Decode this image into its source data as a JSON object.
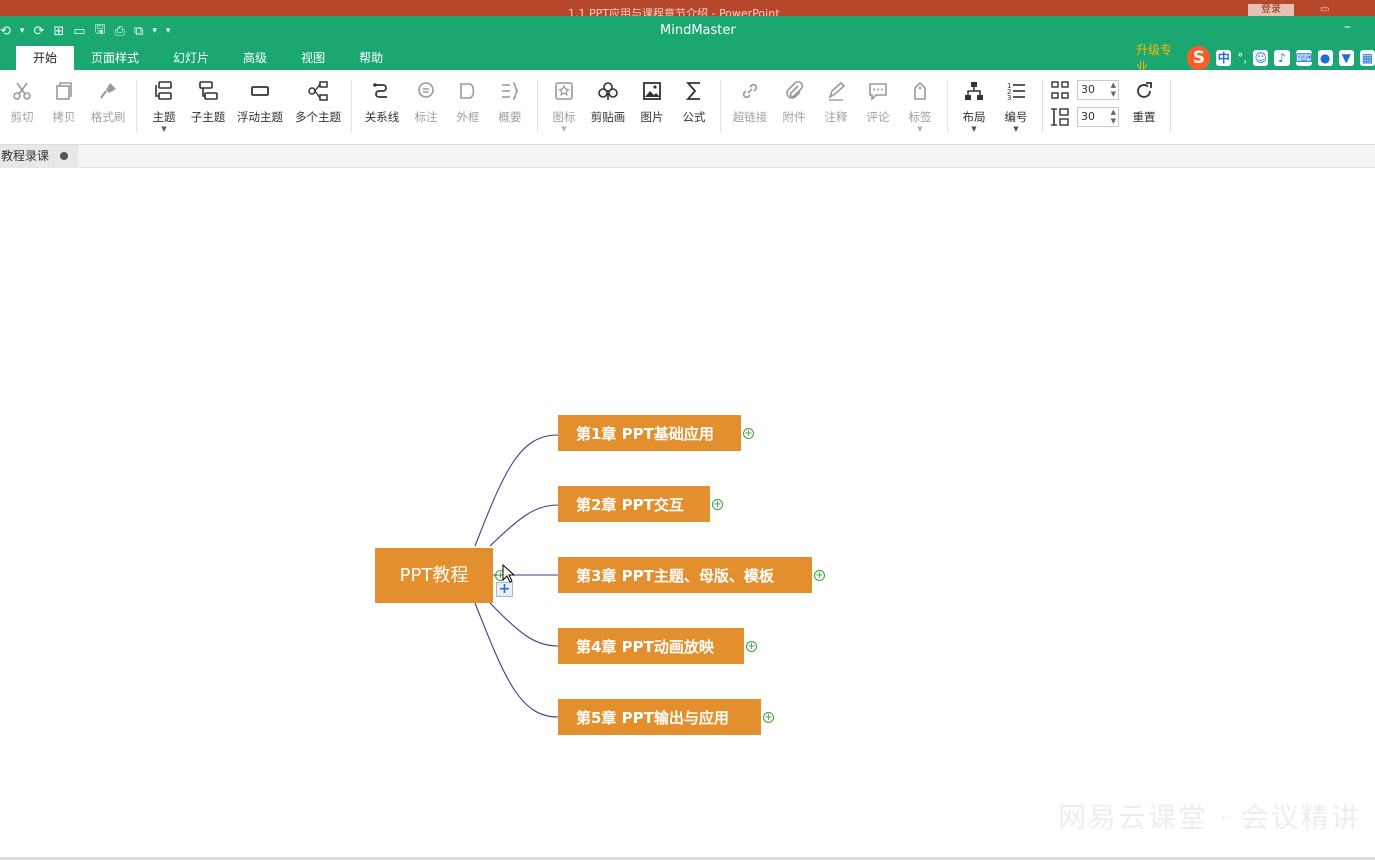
{
  "ppt_window": {
    "title": "1.1 PPT应用与课程章节介绍  -  PowerPoint",
    "login": "登录"
  },
  "app": {
    "title": "MindMaster",
    "minimize": "–"
  },
  "qat": {
    "items": [
      "⟲",
      "▾",
      "⟳",
      "⊞",
      "▭",
      "🖫",
      "⎙",
      "⧉",
      "▾",
      "▾"
    ]
  },
  "tabs": [
    "开始",
    "页面样式",
    "幻灯片",
    "高级",
    "视图",
    "帮助"
  ],
  "active_tab": "开始",
  "ime": {
    "upgrade": "升级专业",
    "s": "S",
    "zh": "中",
    "punct": "°,"
  },
  "ribbon": {
    "buttons": [
      {
        "label": "剪切",
        "icon": "scissors-icon",
        "disabled": true
      },
      {
        "label": "拷贝",
        "icon": "copy-icon",
        "disabled": true
      },
      {
        "label": "格式刷",
        "icon": "format-painter-icon",
        "disabled": true
      },
      {
        "label": "主题",
        "icon": "topic-icon",
        "disabled": false,
        "caret": true
      },
      {
        "label": "子主题",
        "icon": "subtopic-icon",
        "disabled": false
      },
      {
        "label": "浮动主题",
        "icon": "floating-topic-icon",
        "disabled": false
      },
      {
        "label": "多个主题",
        "icon": "multiple-topics-icon",
        "disabled": false
      },
      {
        "label": "关系线",
        "icon": "relationship-icon",
        "disabled": false
      },
      {
        "label": "标注",
        "icon": "callout-icon",
        "disabled": true
      },
      {
        "label": "外框",
        "icon": "boundary-icon",
        "disabled": true
      },
      {
        "label": "概要",
        "icon": "summary-icon",
        "disabled": true
      },
      {
        "label": "图标",
        "icon": "mark-icon",
        "disabled": true,
        "caret": true
      },
      {
        "label": "剪贴画",
        "icon": "clipart-icon",
        "disabled": false
      },
      {
        "label": "图片",
        "icon": "picture-icon",
        "disabled": false
      },
      {
        "label": "公式",
        "icon": "formula-icon",
        "disabled": false
      },
      {
        "label": "超链接",
        "icon": "hyperlink-icon",
        "disabled": true
      },
      {
        "label": "附件",
        "icon": "attachment-icon",
        "disabled": true
      },
      {
        "label": "注释",
        "icon": "note-icon",
        "disabled": true
      },
      {
        "label": "评论",
        "icon": "comment-icon",
        "disabled": true
      },
      {
        "label": "标签",
        "icon": "tag-icon",
        "disabled": true,
        "caret": true
      },
      {
        "label": "布局",
        "icon": "layout-icon",
        "disabled": false,
        "caret": true
      },
      {
        "label": "编号",
        "icon": "numbering-icon",
        "disabled": false,
        "caret": true
      },
      {
        "label": "重置",
        "icon": "reset-icon",
        "disabled": false
      }
    ],
    "spacing_h": "30",
    "spacing_v": "30"
  },
  "document_tab": {
    "label": "教程录课"
  },
  "mindmap": {
    "central": "PPT教程",
    "topics": [
      "第1章  PPT基础应用",
      "第2章  PPT交互",
      "第3章  PPT主题、母版、模板",
      "第4章  PPT动画放映",
      "第5章  PPT输出与应用"
    ],
    "topic_color": "#e48f2e",
    "connector_color": "#3a3f86",
    "add_symbol": "+",
    "expand_symbol": "+"
  },
  "watermark": "网易云课堂 · 会议精讲"
}
